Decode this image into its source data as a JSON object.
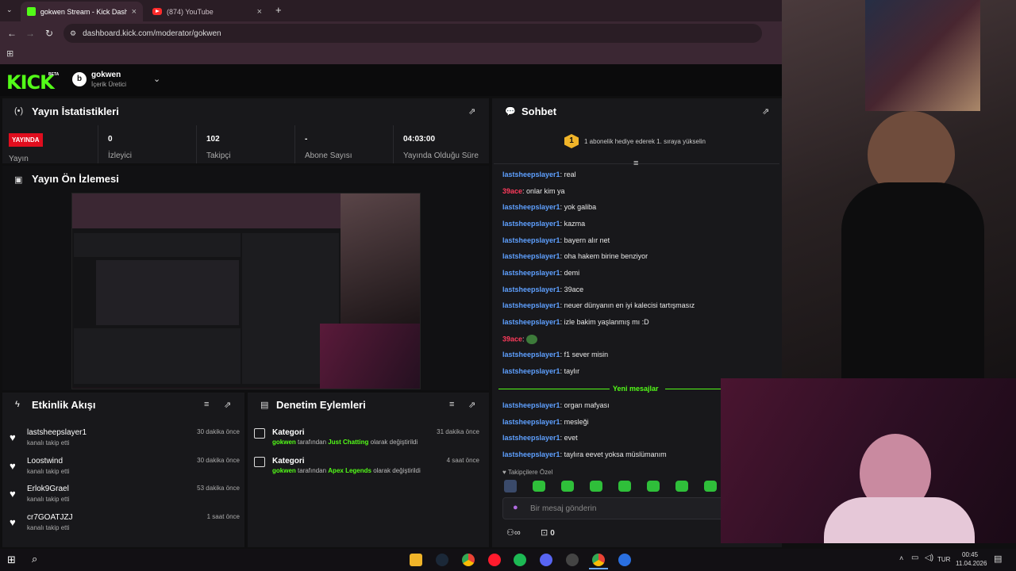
{
  "browser": {
    "tabs": [
      {
        "title": "gokwen Stream - Kick Dashboard"
      },
      {
        "title": "(874) YouTube"
      }
    ],
    "url": "dashboard.kick.com/moderator/gokwen"
  },
  "header": {
    "logo": "KICK",
    "beta": "BETA",
    "avatar_letter": "b",
    "user": "gokwen",
    "role": "İçerik Üretici"
  },
  "stats": {
    "title": "Yayın İstatistikleri",
    "live_badge": "YAYINDA",
    "live_label": "Yayın",
    "items": [
      {
        "value": "0",
        "label": "İzleyici"
      },
      {
        "value": "102",
        "label": "Takipçi"
      },
      {
        "value": "-",
        "label": "Abone Sayısı"
      },
      {
        "value": "04:03:00",
        "label": "Yayında Olduğu Süre"
      }
    ]
  },
  "preview": {
    "title": "Yayın Ön İzlemesi"
  },
  "activity": {
    "title": "Etkinlik Akışı",
    "items": [
      {
        "name": "lastsheepslayer1",
        "sub": "kanalı takip etti",
        "time": "30 dakika önce"
      },
      {
        "name": "Loostwind",
        "sub": "kanalı takip etti",
        "time": "30 dakika önce"
      },
      {
        "name": "Erlok9Grael",
        "sub": "kanalı takip etti",
        "time": "53 dakika önce"
      },
      {
        "name": "cr7GOATJZJ",
        "sub": "kanalı takip etti",
        "time": "1 saat önce"
      }
    ]
  },
  "moderation": {
    "title": "Denetim Eylemleri",
    "items": [
      {
        "title": "Kategori",
        "by": "gokwen",
        "mid": "tarafından",
        "value": "Just Chatting",
        "end": "olarak değiştirildi",
        "time": "31 dakika önce"
      },
      {
        "title": "Kategori",
        "by": "gokwen",
        "mid": "tarafından",
        "value": "Apex Legends",
        "end": "olarak değiştirildi",
        "time": "4 saat önce"
      }
    ]
  },
  "chat": {
    "title": "Sohbet",
    "gift_rank": "1",
    "gift_text": "1 abonelik hediye ederek 1. sıraya yükselin",
    "messages": [
      {
        "user": "lastsheepslayer1",
        "text": "real",
        "color": "#5ea0ff"
      },
      {
        "user": "39ace",
        "text": "onlar kim ya",
        "color": "#ff3b5c"
      },
      {
        "user": "lastsheepslayer1",
        "text": "yok galiba",
        "color": "#5ea0ff"
      },
      {
        "user": "lastsheepslayer1",
        "text": "kazma",
        "color": "#5ea0ff"
      },
      {
        "user": "lastsheepslayer1",
        "text": "bayern alır net",
        "color": "#5ea0ff"
      },
      {
        "user": "lastsheepslayer1",
        "text": "oha hakem birine benziyor",
        "color": "#5ea0ff"
      },
      {
        "user": "lastsheepslayer1",
        "text": "demi",
        "color": "#5ea0ff"
      },
      {
        "user": "lastsheepslayer1",
        "text": "39ace",
        "color": "#5ea0ff"
      },
      {
        "user": "lastsheepslayer1",
        "text": "neuer dünyanın en iyi kalecisi tartışmasız",
        "color": "#5ea0ff"
      },
      {
        "user": "lastsheepslayer1",
        "text": "izle bakim yaşlanmış mı :D",
        "color": "#5ea0ff"
      },
      {
        "user": "39ace",
        "text": "",
        "color": "#ff3b5c"
      },
      {
        "user": "lastsheepslayer1",
        "text": "f1 sever misin",
        "color": "#5ea0ff"
      },
      {
        "user": "lastsheepslayer1",
        "text": "taylır",
        "color": "#5ea0ff"
      }
    ],
    "new_messages_label": "Yeni mesajlar",
    "new_messages": [
      {
        "user": "lastsheepslayer1",
        "text": "organ mafyası"
      },
      {
        "user": "lastsheepslayer1",
        "text": "mesleği"
      },
      {
        "user": "lastsheepslayer1",
        "text": "evet"
      },
      {
        "user": "lastsheepslayer1",
        "text": "taylıra eevet yoksa müslümanım"
      }
    ],
    "followers_only": "Takipçilere Özel",
    "input_placeholder": "Bir mesaj gönderin",
    "infinity": "∞",
    "gift_count": "0"
  },
  "taskbar": {
    "lang": "TUR",
    "time": "00:45",
    "date": "11.04.2026"
  },
  "colors": {
    "kick_green": "#53fc18",
    "live_red": "#e00d1e",
    "username_blue": "#5ea0ff",
    "username_red": "#ff3b5c"
  }
}
